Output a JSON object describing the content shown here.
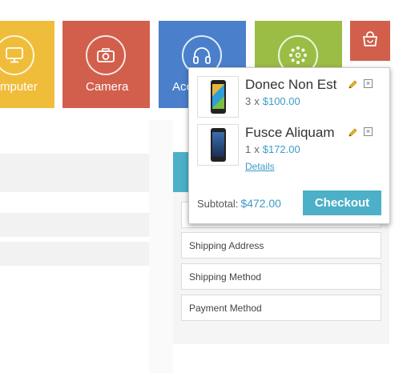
{
  "tiles": [
    {
      "label": "mputer",
      "icon": "monitor-icon",
      "color": "#f0bd3a"
    },
    {
      "label": "Camera",
      "icon": "camera-icon",
      "color": "#d15f4c"
    },
    {
      "label": "Acc",
      "icon": "headphones-icon",
      "color": "#4a7fcb"
    },
    {
      "label": "",
      "icon": "dots-ring-icon",
      "color": "#9bbd46"
    }
  ],
  "cart_button": {
    "icon": "shopping-bag-icon",
    "color": "#d15f4c"
  },
  "cart": {
    "items": [
      {
        "name": "Donec Non Est",
        "quantity": "3",
        "times": "x",
        "price": "$100.00",
        "image": "phone-lumia"
      },
      {
        "name": "Fusce Aliquam",
        "quantity": "1",
        "times": "x",
        "price": "$172.00",
        "link": "Details",
        "image": "phone-blackberry"
      }
    ],
    "subtotal_label": "Subtotal:",
    "subtotal_value": "$472.00",
    "checkout_label": "Checkout"
  },
  "checkout_steps": [
    {
      "label": ""
    },
    {
      "label": "Shipping Address"
    },
    {
      "label": "Shipping Method"
    },
    {
      "label": "Payment Method"
    }
  ],
  "colors": {
    "accent": "#4bb0c8",
    "link": "#3d9bc8"
  }
}
